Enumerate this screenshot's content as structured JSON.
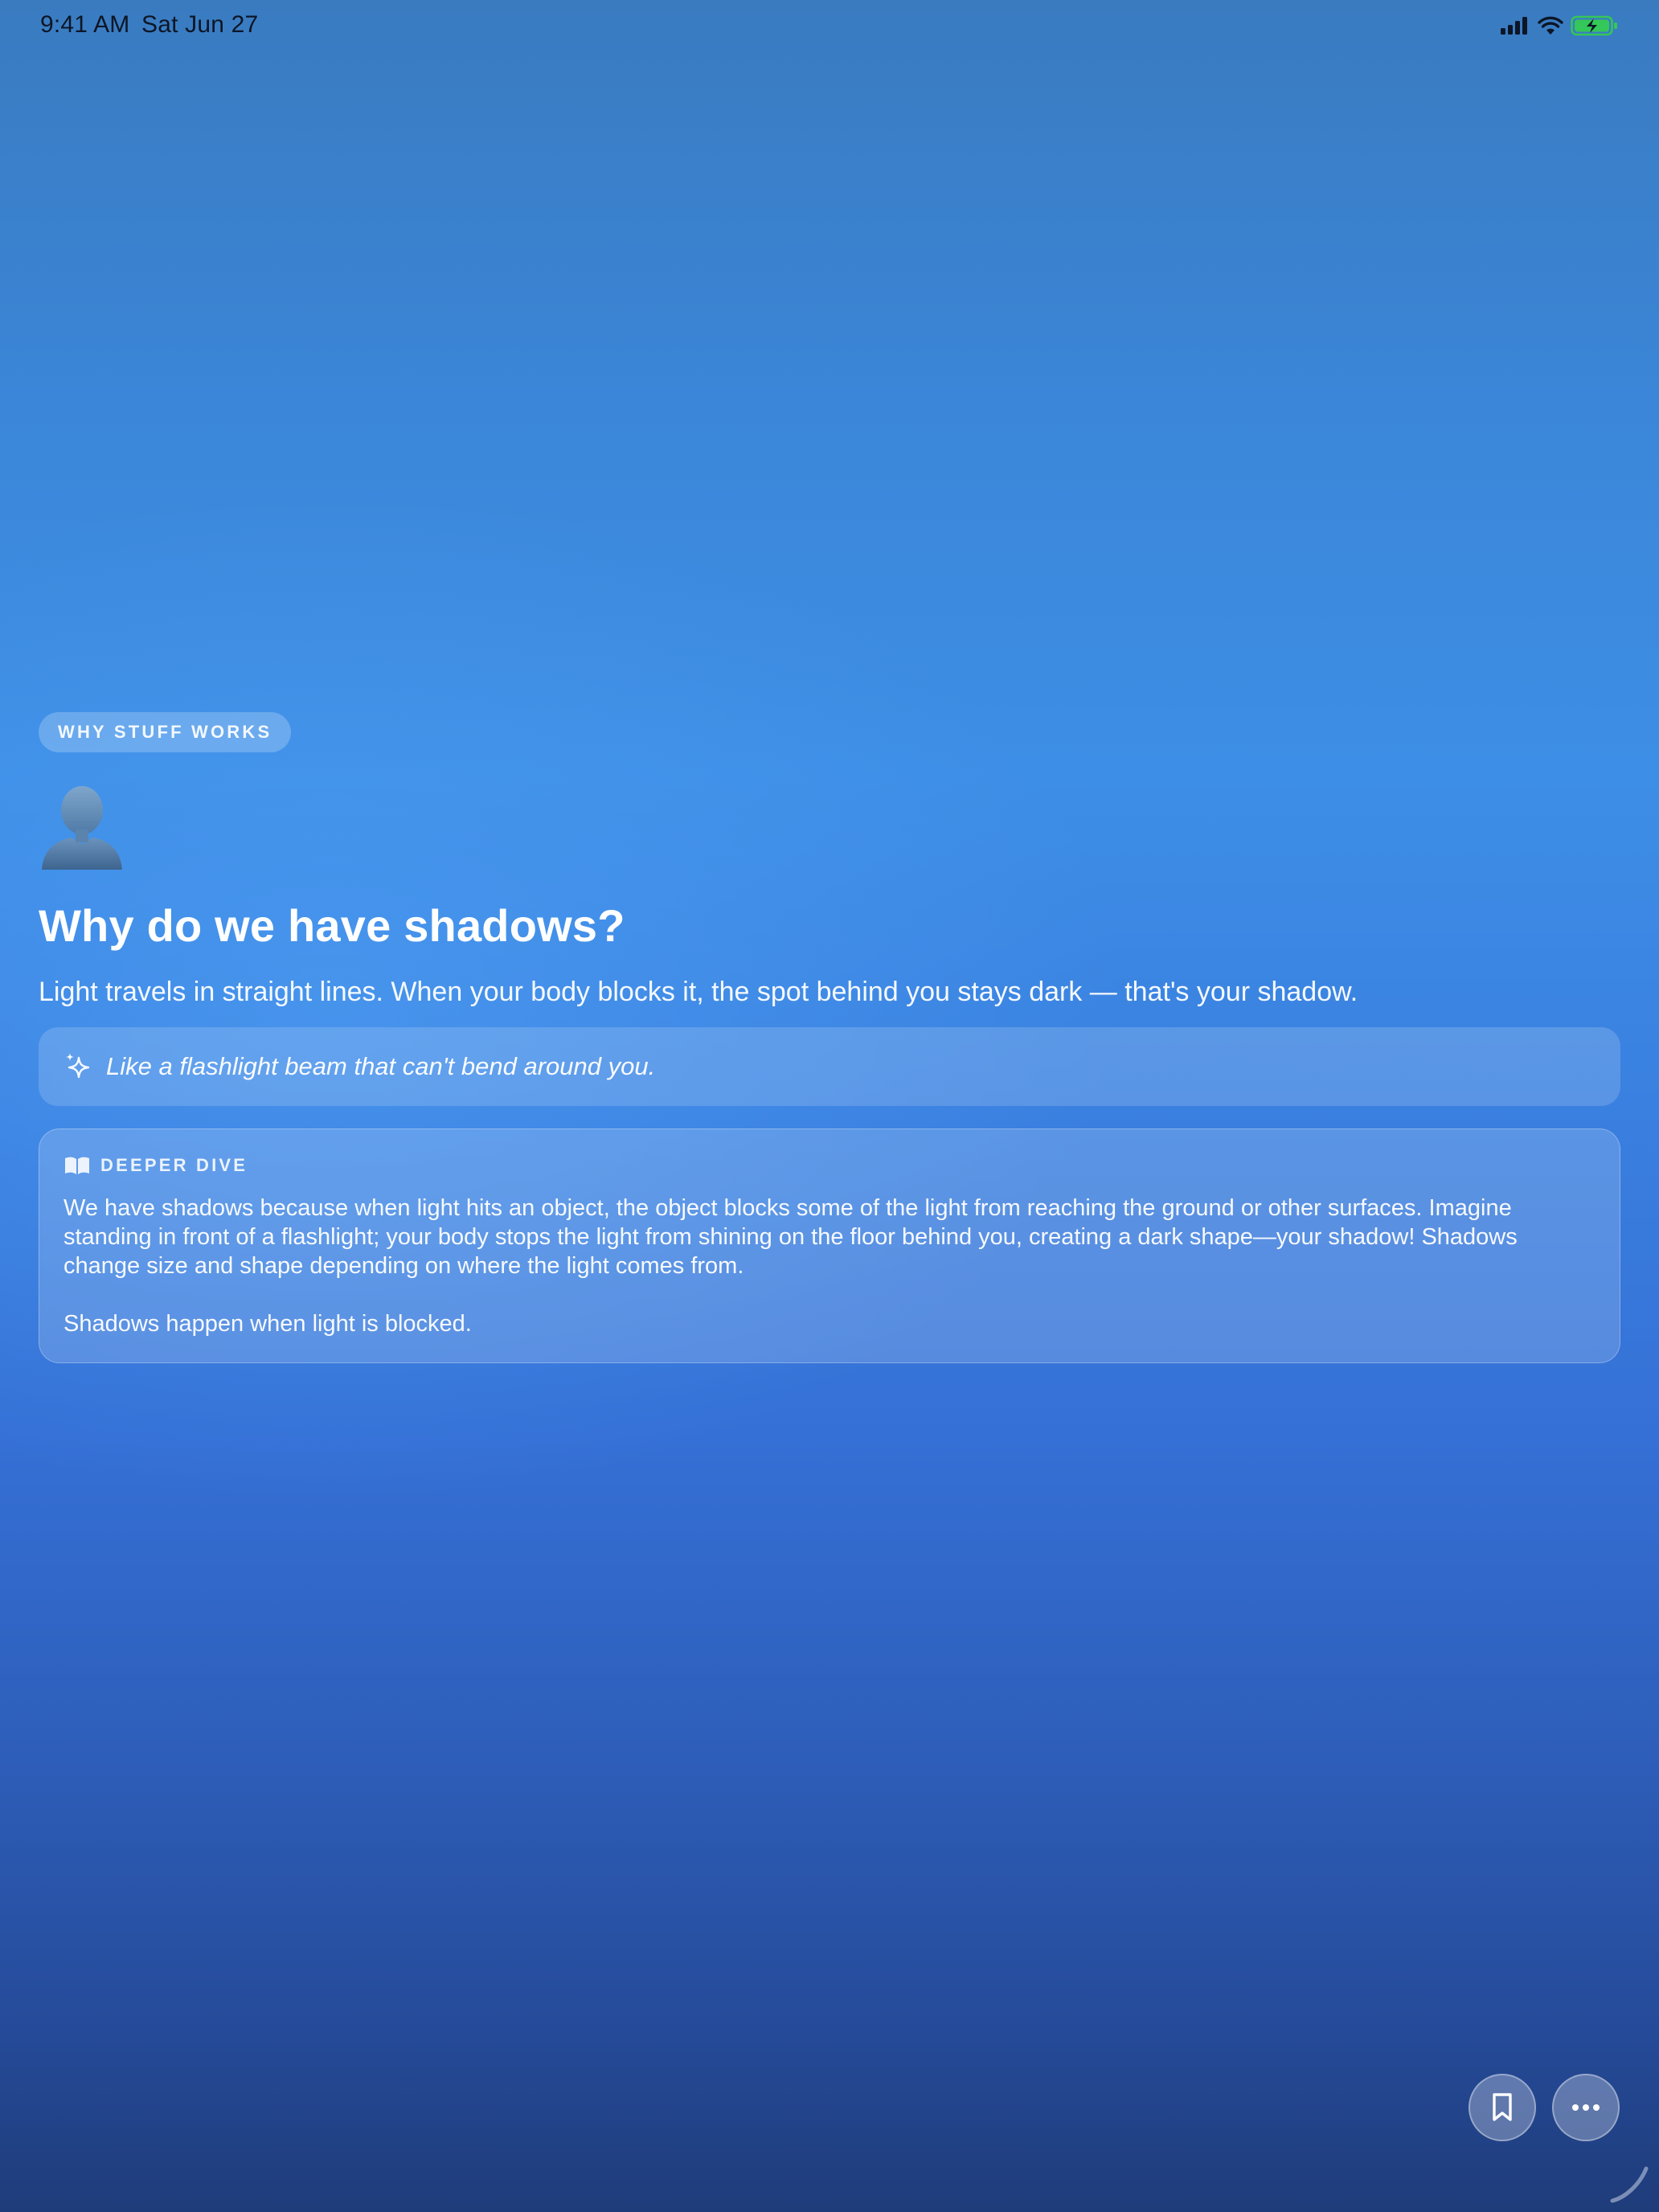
{
  "status_bar": {
    "time": "9:41 AM",
    "date": "Sat Jun 27",
    "icons": [
      "cellular-signal-icon",
      "wifi-icon",
      "battery-charging-icon"
    ],
    "battery_color": "#34c759"
  },
  "card": {
    "category": "WHY STUFF WORKS",
    "emoji": "bust-in-silhouette",
    "title": "Why do we have shadows?",
    "summary": "Light travels in straight lines. When your body blocks it, the spot behind you stays dark — that's your shadow.",
    "analogy": {
      "icon": "sparkle-icon",
      "text": "Like a flashlight beam that can't bend around you."
    },
    "deeper_dive": {
      "icon": "book-icon",
      "label": "DEEPER DIVE",
      "body": "We have shadows because when light hits an object, the object blocks some of the light from reaching the ground or other surfaces. Imagine standing in front of a flashlight; your body stops the light from shining on the floor behind you, creating a dark shape—your shadow! Shadows change size and shape depending on where the light comes from.",
      "summary": "Shadows happen when light is blocked."
    }
  },
  "actions": {
    "bookmark_icon": "bookmark-icon",
    "more_icon": "ellipsis-icon"
  },
  "colors": {
    "background_top": "#3a7bc0",
    "background_mid": "#3d8ee6",
    "background_bottom": "#1f3c7a"
  }
}
